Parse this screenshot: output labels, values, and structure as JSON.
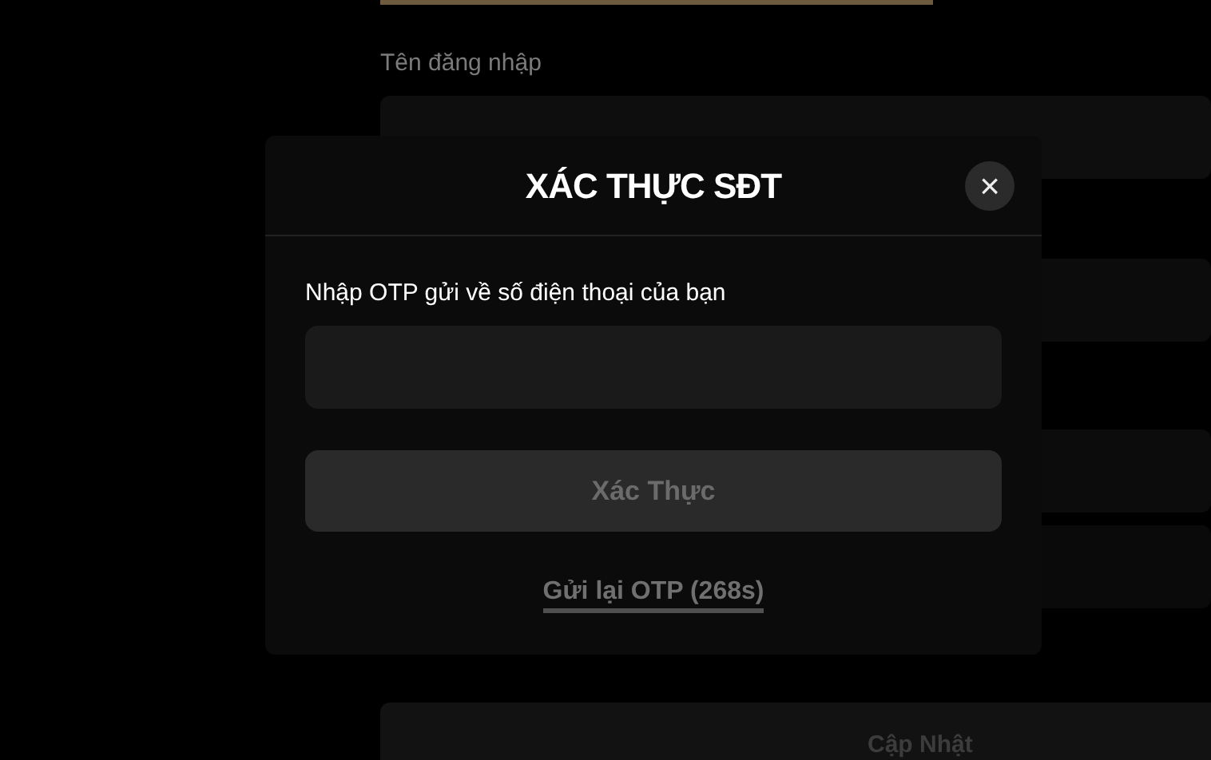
{
  "background_form": {
    "username_label": "Tên đăng nhập",
    "submit_button": "Cập Nhật"
  },
  "modal": {
    "title": "XÁC THỰC SĐT",
    "close": "×",
    "otp_label": "Nhập OTP gửi về số điện thoại của bạn",
    "verify_button": {
      "label": "Xác Thực",
      "disabled": true
    },
    "resend_link": "Gửi lại OTP (268s)"
  }
}
